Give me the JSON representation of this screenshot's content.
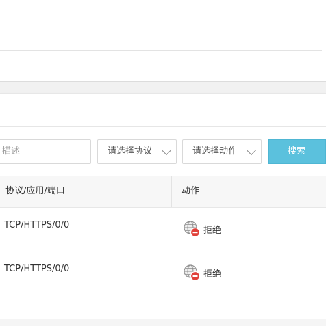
{
  "filters": {
    "description_placeholder": "描述",
    "protocol_select": "请选择协议",
    "action_select": "请选择动作",
    "search_button": "搜索"
  },
  "table": {
    "columns": [
      "协议/应用/端口",
      "动作"
    ],
    "rows": [
      {
        "protocol": "TCP/HTTPS/0/0",
        "action": "拒绝"
      },
      {
        "protocol": "TCP/HTTPS/0/0",
        "action": "拒绝"
      }
    ]
  },
  "colors": {
    "accent": "#5bc1dd",
    "deny": "#e0413a"
  },
  "icons": {
    "deny": "globe-deny-icon",
    "dropdown": "chevron-down-icon"
  }
}
